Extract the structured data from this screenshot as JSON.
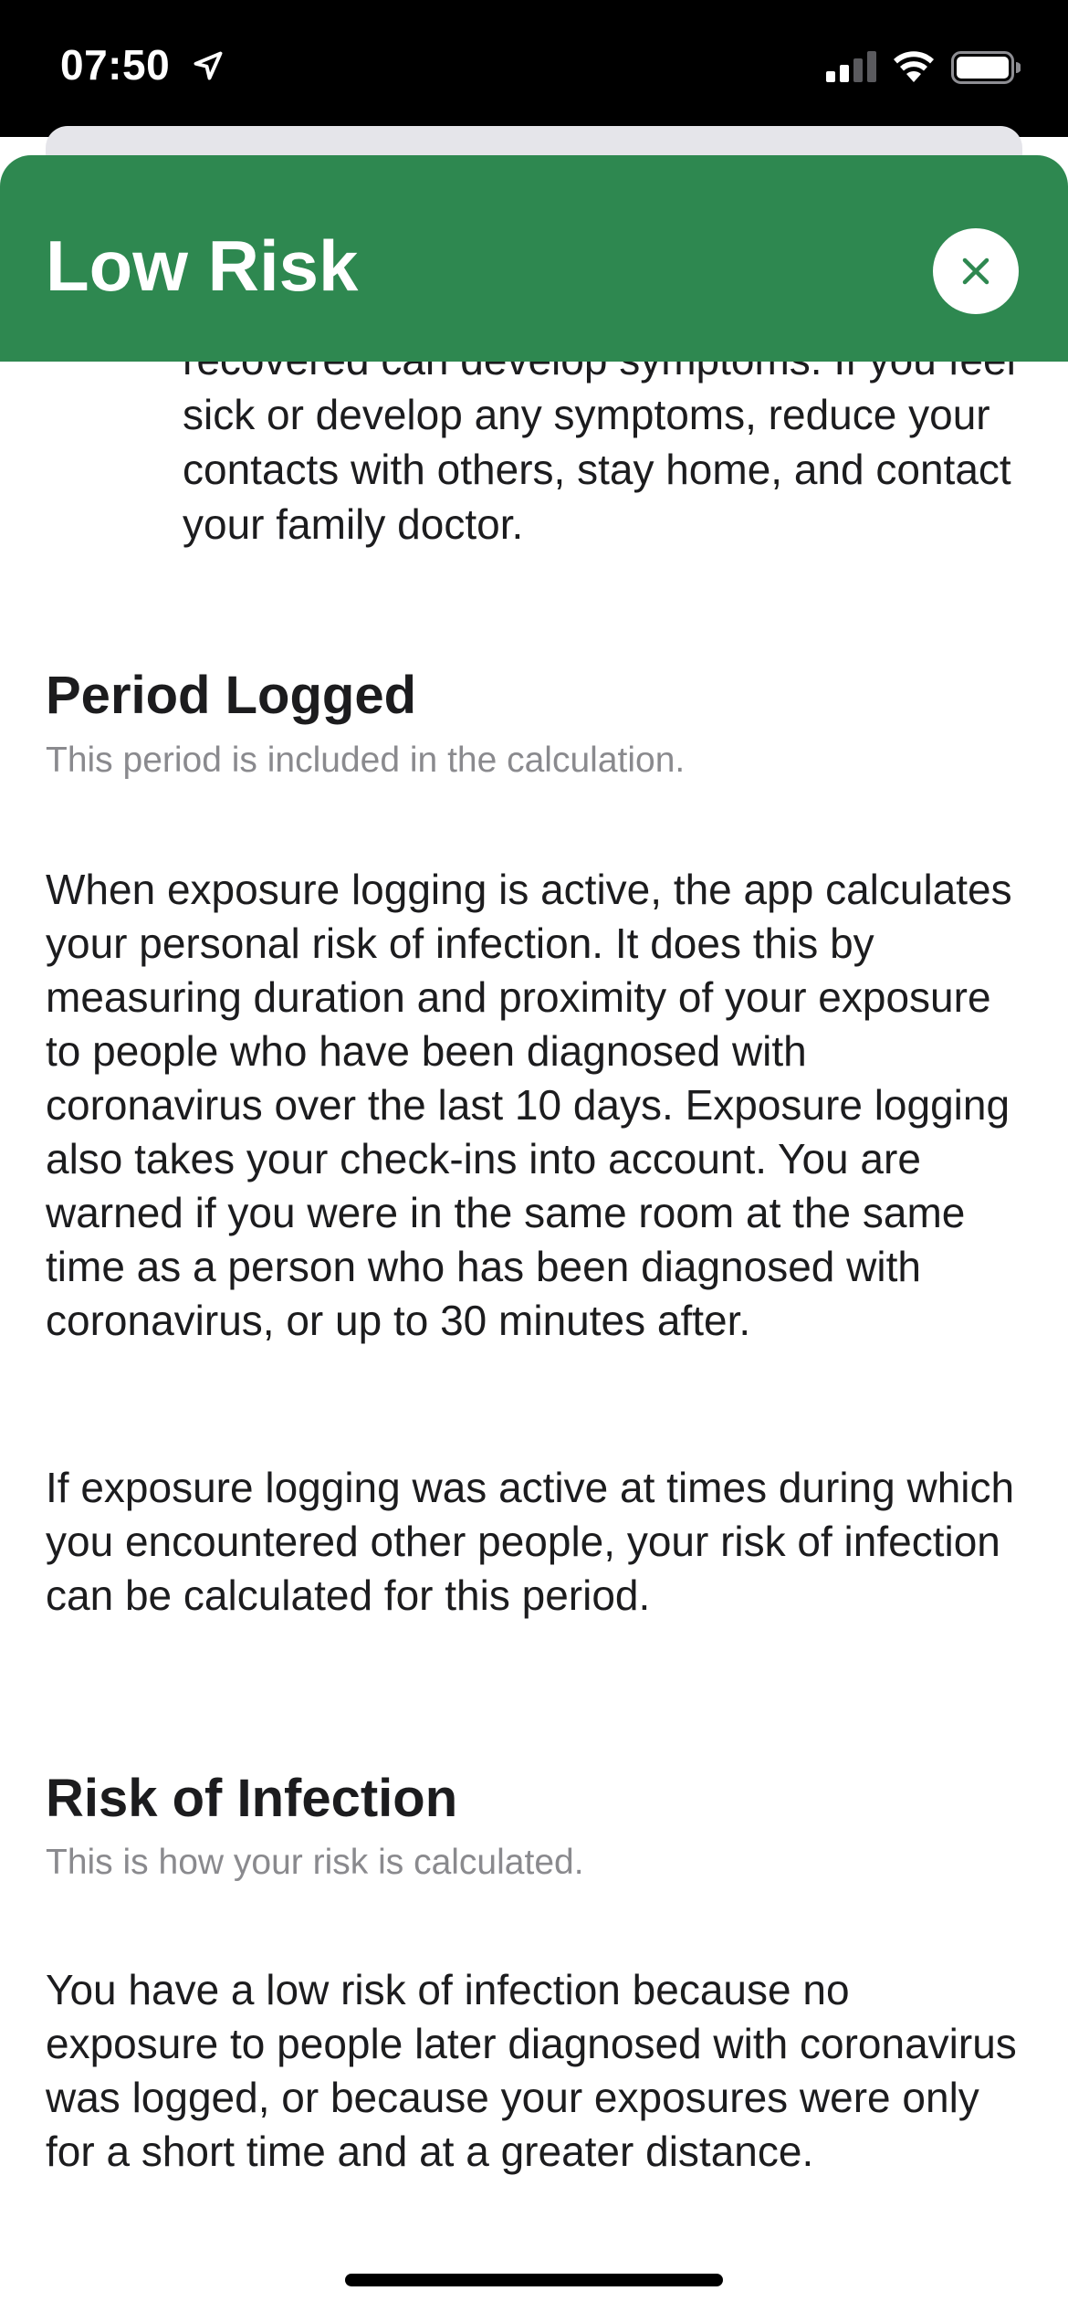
{
  "status_bar": {
    "time": "07:50"
  },
  "header": {
    "title": "Low Risk"
  },
  "content": {
    "top_paragraph": "recovered can develop symptoms. If you feel sick or develop any symptoms, reduce your contacts with others, stay home, and contact your family doctor.",
    "sections": [
      {
        "title": "Period Logged",
        "subtitle": "This period is included in the calculation.",
        "paragraphs": [
          "When exposure logging is active, the app calculates your personal risk of infection. It does this by measuring duration and proximity of your exposure to people who have been diagnosed with coronavirus over the last 10 days. Exposure logging also takes your check-ins into account. You are warned if you were in the same room at the same time as a person who has been diagnosed with coronavirus, or up to 30 minutes after.",
          "If exposure logging was active at times during which you encountered other people, your risk of infection can be calculated for this period."
        ]
      },
      {
        "title": "Risk of Infection",
        "subtitle": "This is how your risk is calculated.",
        "paragraphs": [
          "You have a low risk of infection because no exposure to people later diagnosed with coronavirus was logged, or because your exposures were only for a short time and at a greater distance."
        ]
      }
    ]
  },
  "colors": {
    "header_background": "#2e8850",
    "close_icon": "#2e8850",
    "subtitle_text": "#8a8a8e"
  }
}
